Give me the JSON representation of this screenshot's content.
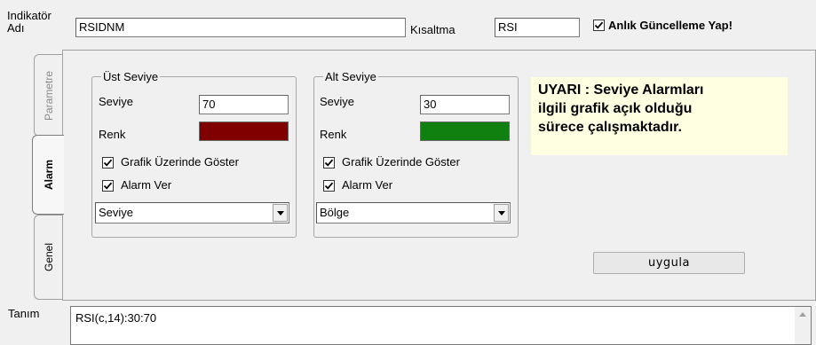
{
  "header": {
    "indicator_name_label_line1": "Indikatör",
    "indicator_name_label_line2": "Adı",
    "indicator_name_value": "RSIDNM",
    "short_label": "Kısaltma",
    "short_value": "RSI",
    "live_update_label": "Anlık Güncelleme Yap!",
    "live_update_checked": true
  },
  "tabs": [
    {
      "label": "Parametre",
      "active": false
    },
    {
      "label": "Alarm",
      "active": true
    },
    {
      "label": "Genel",
      "active": false
    }
  ],
  "upper": {
    "title": "Üst Seviye",
    "level_label": "Seviye",
    "level_value": "70",
    "color_label": "Renk",
    "color": "#800000",
    "show_on_chart_label": "Grafik Üzerinde Göster",
    "show_on_chart_checked": true,
    "alarm_label": "Alarm Ver",
    "alarm_checked": true,
    "mode_value": "Seviye"
  },
  "lower": {
    "title": "Alt Seviye",
    "level_label": "Seviye",
    "level_value": "30",
    "color_label": "Renk",
    "color": "#108010",
    "show_on_chart_label": "Grafik Üzerinde Göster",
    "show_on_chart_checked": true,
    "alarm_label": "Alarm Ver",
    "alarm_checked": true,
    "mode_value": "Bölge"
  },
  "warning": {
    "line1": "UYARI : Seviye Alarmları",
    "line2": "ilgili grafik açık olduğu",
    "line3": "sürece çalışmaktadır."
  },
  "apply_button": "uygula",
  "definition": {
    "label": "Tanım",
    "value": "RSI(c,14):30:70"
  }
}
